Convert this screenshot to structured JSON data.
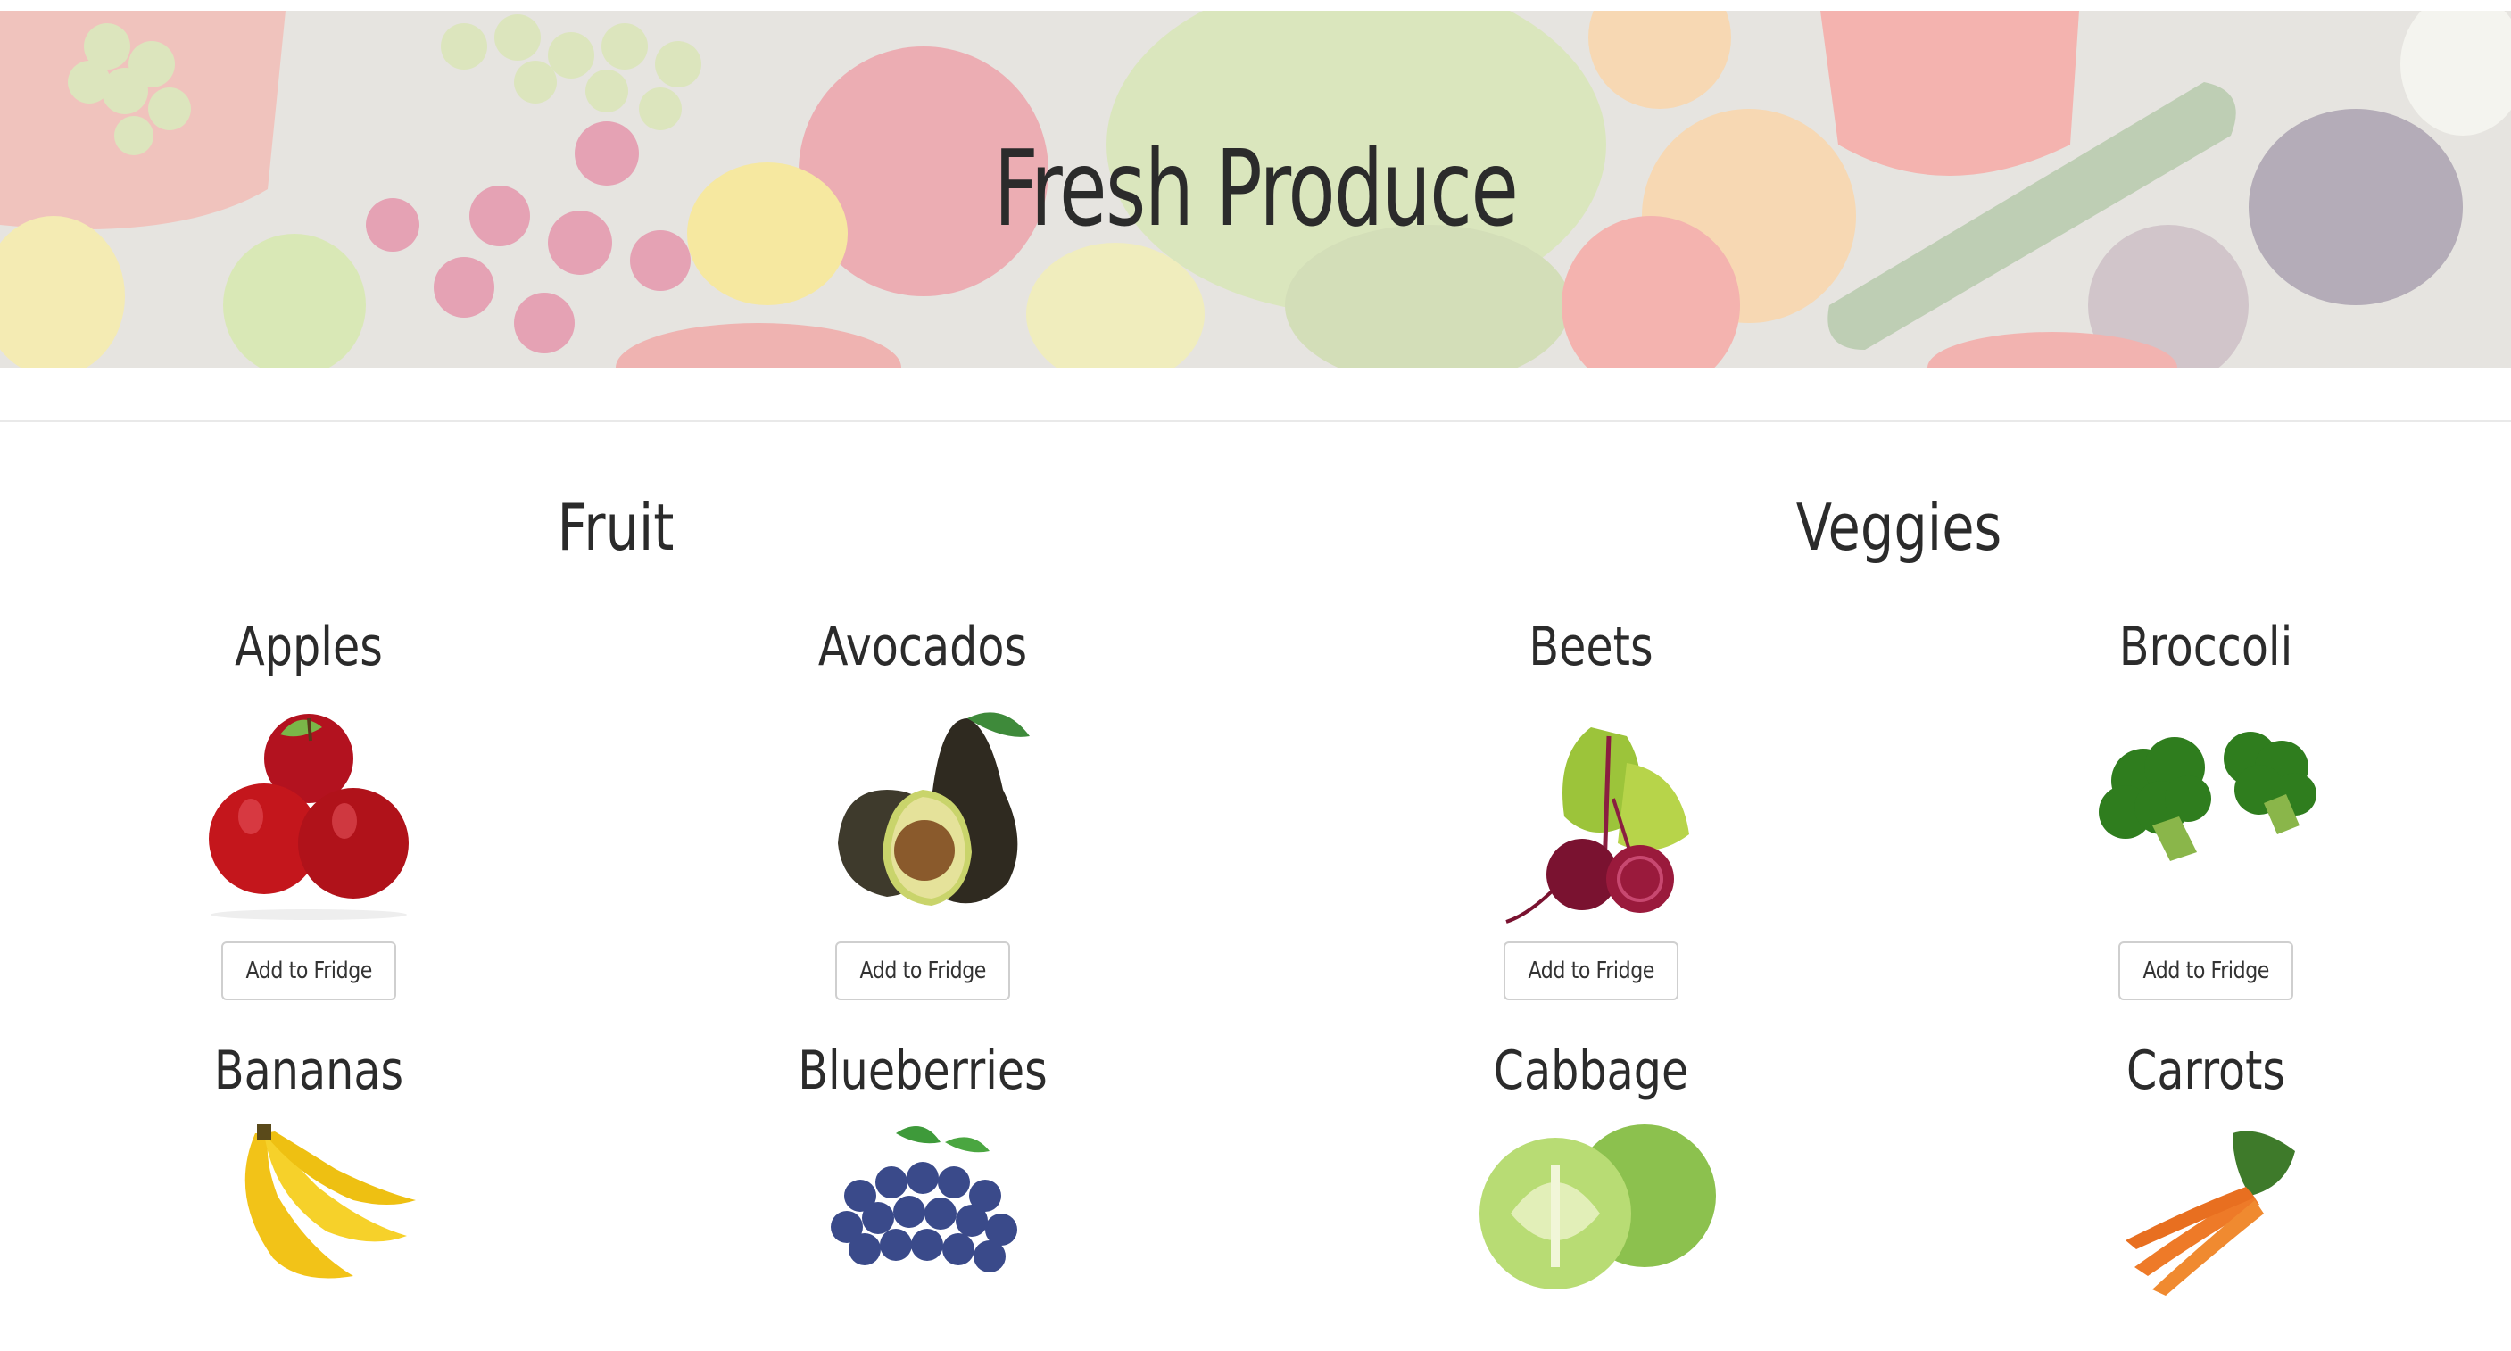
{
  "header": {
    "title": "Fresh Produce"
  },
  "sections": {
    "fruit": {
      "title": "Fruit"
    },
    "veggies": {
      "title": "Veggies"
    }
  },
  "items": {
    "apples": {
      "name": "Apples",
      "button": "Add to Fridge",
      "icon": "apples-image"
    },
    "avocados": {
      "name": "Avocados",
      "button": "Add to Fridge",
      "icon": "avocados-image"
    },
    "beets": {
      "name": "Beets",
      "button": "Add to Fridge",
      "icon": "beets-image"
    },
    "broccoli": {
      "name": "Broccoli",
      "button": "Add to Fridge",
      "icon": "broccoli-image"
    },
    "bananas": {
      "name": "Bananas",
      "icon": "bananas-image"
    },
    "blueberries": {
      "name": "Blueberries",
      "icon": "blueberries-image"
    },
    "cabbage": {
      "name": "Cabbage",
      "icon": "cabbage-image"
    },
    "carrots": {
      "name": "Carrots",
      "icon": "carrots-image"
    }
  },
  "colors": {
    "text": "#2b2b2b",
    "button_border": "#cfcfcf",
    "divider": "#e9e9e9"
  }
}
